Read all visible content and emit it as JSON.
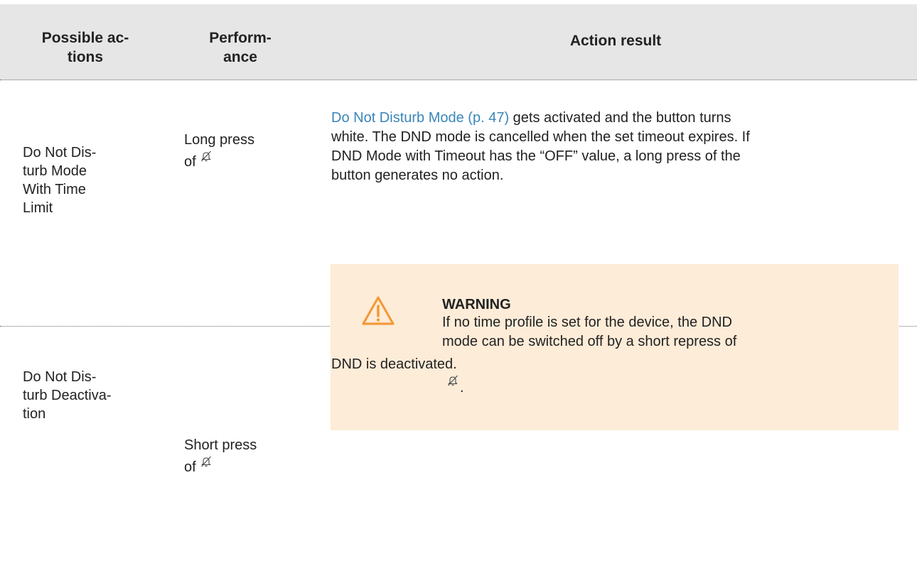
{
  "table": {
    "headers": {
      "actions": "Possible ac-\ntions",
      "performance": "Perform-\nance",
      "result": "Action result"
    },
    "rows": [
      {
        "action": "Do Not Dis-\nturb Mode\nWith Time\nLimit",
        "performance_prefix": "Long press",
        "performance_of": "of",
        "performance_icon": "bell-off-icon",
        "result_link": "Do Not Disturb Mode (p. 47)",
        "result_text": " gets activated and the button turns\nwhite. The DND mode is cancelled when the set timeout expires. If\nDND Mode with Timeout has the “OFF” value, a long press of the\nbutton generates no action.",
        "warning": {
          "title": "WARNING",
          "body": "If no time profile is set for the device, the DND\nmode can be switched off by a short repress of",
          "icon": "bell-off-icon",
          "trailing": "."
        }
      },
      {
        "action": "Do Not Dis-\nturb Deactiva-\ntion",
        "performance_prefix": "Short press",
        "performance_of": "of",
        "performance_icon": "bell-off-icon",
        "result_text": "DND is deactivated."
      }
    ]
  },
  "colors": {
    "header_bg": "#e6e6e6",
    "link": "#3a86b8",
    "warning_bg": "#fdecd8",
    "warning_icon": "#f39a3b",
    "text": "#222222"
  }
}
